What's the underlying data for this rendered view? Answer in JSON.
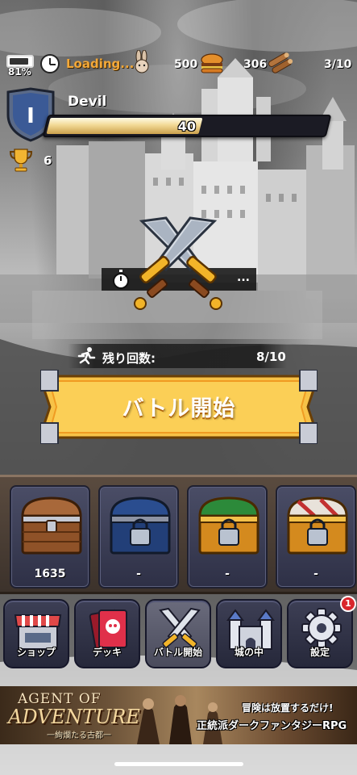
{
  "status_bar": {
    "battery_pct": "81%",
    "loading_text": "Loading...",
    "gold": "500",
    "wood": "306",
    "stamina": "3/10",
    "icons": [
      "battery-icon",
      "clock-icon",
      "rabbit-icon",
      "burger-icon",
      "wood-logs-icon"
    ]
  },
  "player": {
    "rank": "I",
    "name": "Devil",
    "exp_value": "40",
    "exp_fraction": 0.55,
    "trophies": "6"
  },
  "battle": {
    "remaining_label": "残り回数:",
    "remaining_value": "8/10",
    "start_label": "バトル開始",
    "timer_dots": "..."
  },
  "chests": [
    {
      "count": "1635",
      "type": "wooden",
      "locked": false
    },
    {
      "count": "-",
      "type": "blue",
      "locked": true
    },
    {
      "count": "-",
      "type": "green-gold",
      "locked": true
    },
    {
      "count": "-",
      "type": "red-white",
      "locked": true
    }
  ],
  "nav": {
    "shop": "ショップ",
    "deck": "デッキ",
    "battle": "バトル開始",
    "castle": "城の中",
    "settings": "設定",
    "settings_badge": "1"
  },
  "ad": {
    "title_line1": "AGENT OF",
    "title_line2": "ADVENTURE",
    "title_sub": "一絢爛たる古都一",
    "copy1": "冒険は放置するだけ!",
    "copy2": "正統派ダークファンタジーRPG"
  },
  "colors": {
    "accent_orange": "#f3a838",
    "button_yellow": "#f7c247",
    "badge_red": "#d9262c",
    "nav_bg": "#2e3046"
  }
}
